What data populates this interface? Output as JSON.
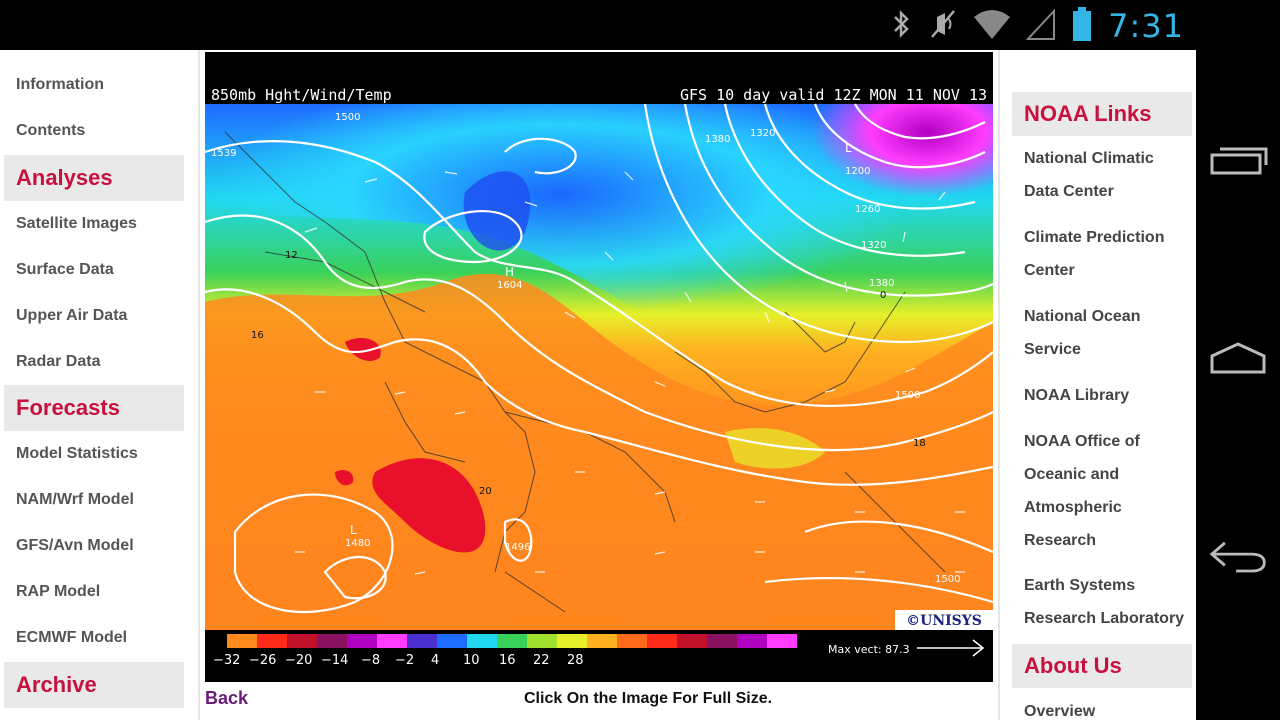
{
  "status_bar": {
    "time": "7:31",
    "icons": [
      "bluetooth-icon",
      "vibrate-off-icon",
      "wifi-icon",
      "cell-signal-icon",
      "battery-icon"
    ]
  },
  "left_nav": {
    "items": [
      {
        "type": "item",
        "label": "Information"
      },
      {
        "type": "item",
        "label": "Contents"
      },
      {
        "type": "heading",
        "label": "Analyses"
      },
      {
        "type": "item",
        "label": "Satellite Images"
      },
      {
        "type": "item",
        "label": "Surface Data"
      },
      {
        "type": "item",
        "label": "Upper Air Data"
      },
      {
        "type": "item",
        "label": "Radar Data"
      },
      {
        "type": "heading",
        "label": "Forecasts"
      },
      {
        "type": "item",
        "label": "Model Statistics"
      },
      {
        "type": "item",
        "label": "NAM/Wrf Model"
      },
      {
        "type": "item",
        "label": "GFS/Avn Model"
      },
      {
        "type": "item",
        "label": "RAP Model"
      },
      {
        "type": "item",
        "label": "ECMWF Model"
      },
      {
        "type": "heading",
        "label": "Archive"
      }
    ]
  },
  "map": {
    "title_left": "850mb Hght/Wind/Temp",
    "title_right": "GFS 10 day valid 12Z MON 11 NOV 13",
    "brand": "©UNISYS",
    "scale_labels": [
      "−32",
      "−26",
      "−20",
      "−14",
      "−8",
      "−2",
      "4",
      "10",
      "16",
      "22",
      "28"
    ],
    "max_vect": "Max vect: 87.3",
    "contour_labels": [
      "1500",
      "1539",
      "1380",
      "1320",
      "1200",
      "1260",
      "1320",
      "1380",
      "1604",
      "1500",
      "1480",
      "1496",
      "1500",
      "12",
      "16",
      "20",
      "18",
      "0",
      "H",
      "L",
      "L"
    ]
  },
  "center": {
    "back_label": "Back",
    "caption": "Click On the Image For Full Size."
  },
  "right_nav": {
    "sections": [
      {
        "heading": "NOAA Links",
        "items": [
          "National Climatic Data Center",
          "Climate Prediction Center",
          "National Ocean Service",
          "NOAA Library",
          "NOAA Office of Oceanic and Atmospheric Research",
          "Earth Systems Research Laboratory"
        ]
      },
      {
        "heading": "About Us",
        "items": [
          "Overview"
        ]
      }
    ]
  },
  "colors": {
    "accent": "#c8103f",
    "link_purple": "#6a1b7a",
    "status_blue": "#33b5e5"
  }
}
